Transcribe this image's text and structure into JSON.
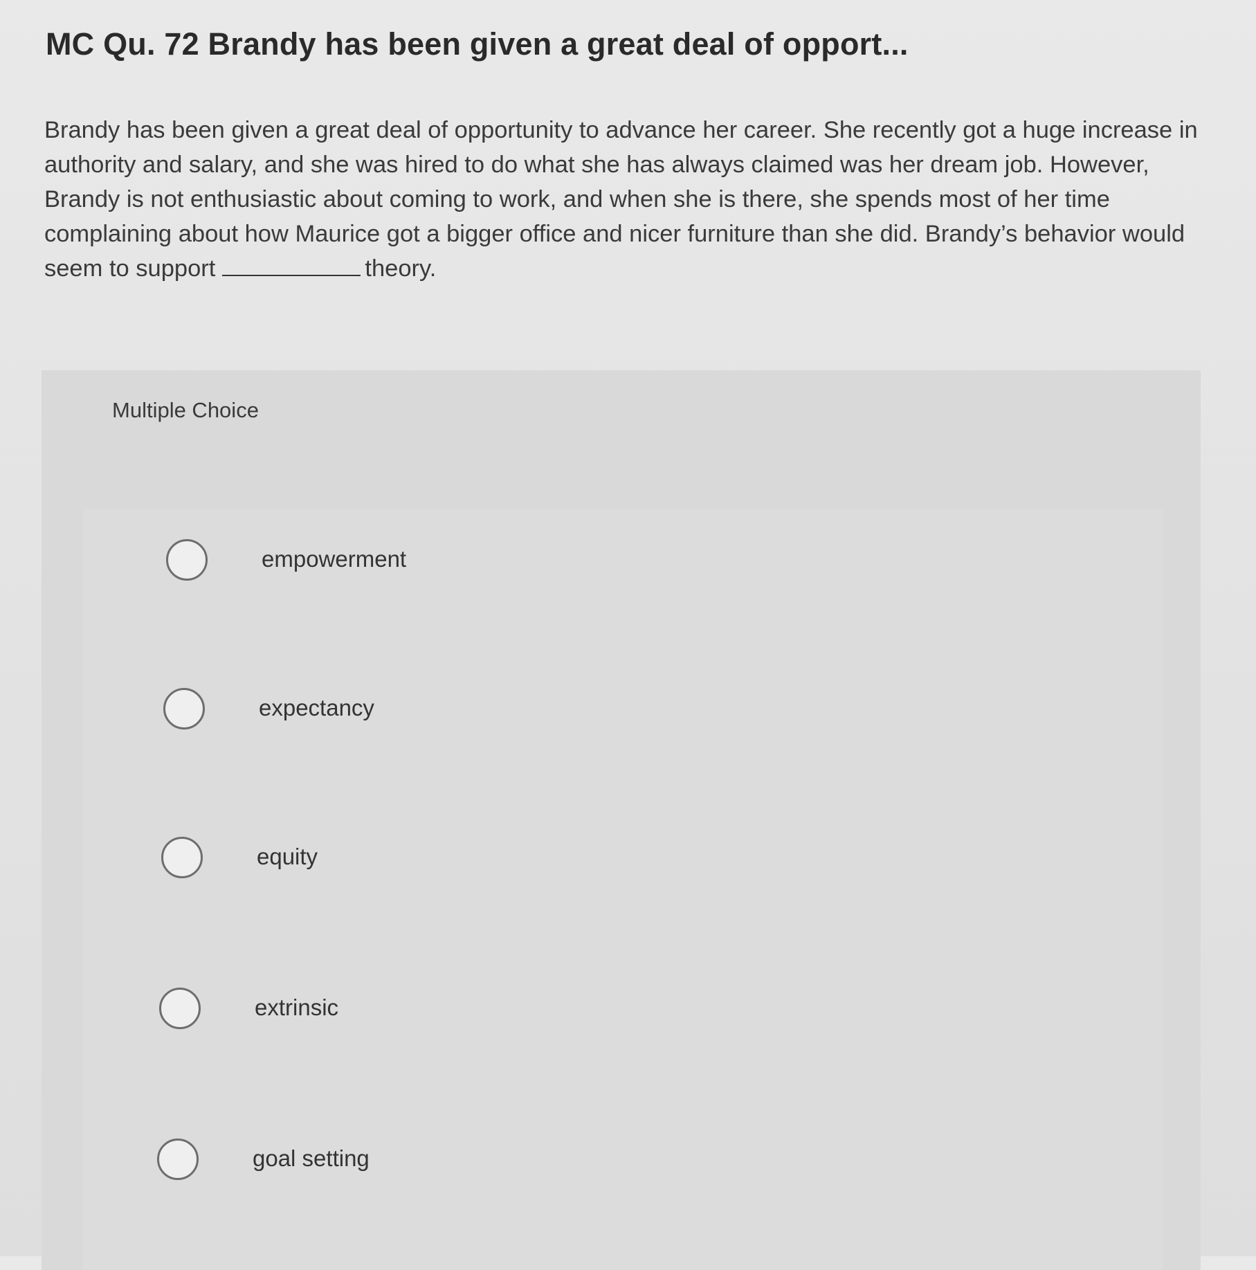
{
  "question": {
    "title": "MC Qu. 72 Brandy has been given a great deal of opport...",
    "body_before_blank": "Brandy has been given a great deal of opportunity to advance her career. She recently got a huge increase in authority and salary, and she was hired to do what she has always claimed was her dream job. However, Brandy is not enthusiastic about coming to work, and when she is there, she spends most of her time complaining about how Maurice got a bigger office and nicer furniture than she did. Brandy’s behavior would seem to support",
    "body_after_blank": "theory."
  },
  "choices": {
    "heading": "Multiple Choice",
    "options": [
      {
        "label": "empowerment",
        "selected": false
      },
      {
        "label": "expectancy",
        "selected": false
      },
      {
        "label": "equity",
        "selected": false
      },
      {
        "label": "extrinsic",
        "selected": false
      },
      {
        "label": "goal setting",
        "selected": false
      }
    ]
  }
}
